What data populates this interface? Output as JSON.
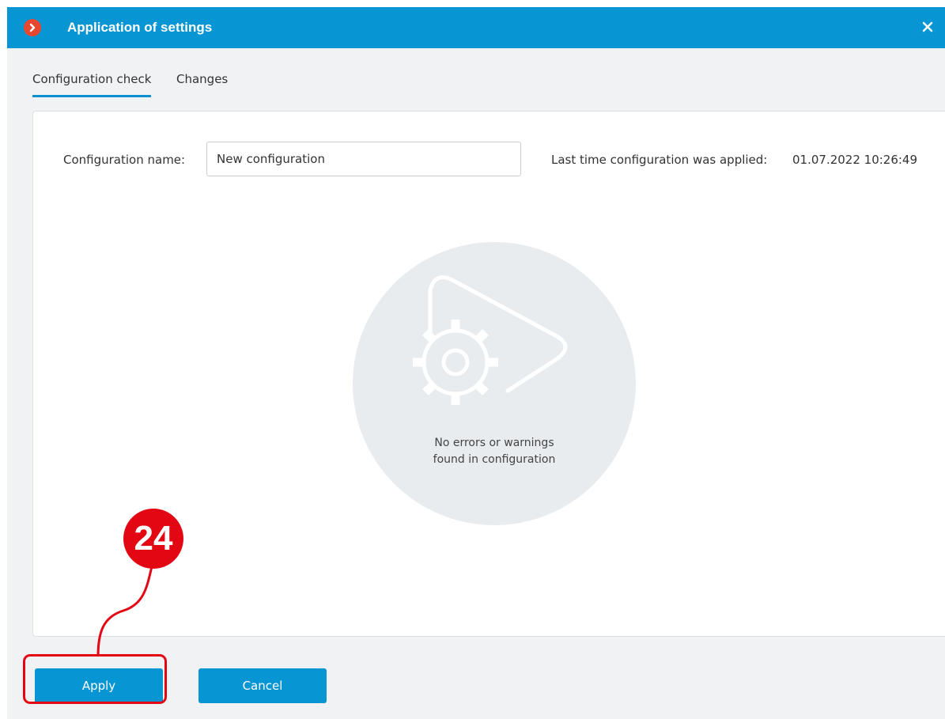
{
  "window": {
    "title": "Application of settings",
    "close_icon": "close-icon",
    "app_icon": "app-chevron-icon"
  },
  "tabs": [
    {
      "label": "Configuration check",
      "active": true
    },
    {
      "label": "Changes",
      "active": false
    }
  ],
  "config": {
    "name_label": "Configuration name:",
    "name_value": "New configuration",
    "last_applied_label": "Last time configuration was applied:",
    "last_applied_value": "01.07.2022 10:26:49"
  },
  "status": {
    "icon": "gear-play-icon",
    "line1": "No errors or warnings",
    "line2": "found in configuration"
  },
  "footer": {
    "apply_label": "Apply",
    "cancel_label": "Cancel"
  },
  "callout": {
    "number": "24"
  },
  "colors": {
    "titlebar": "#0795d3",
    "button": "#0795d3",
    "callout": "#e30613",
    "app_icon": "#e8472f"
  }
}
